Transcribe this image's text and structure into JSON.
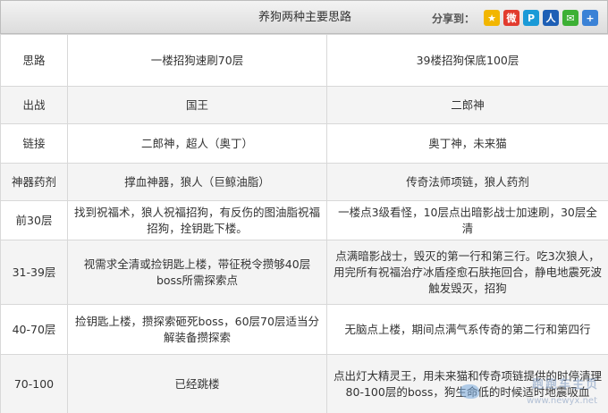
{
  "header": {
    "title": "养狗两种主要思路",
    "share_label": "分享到：",
    "share_icons": [
      {
        "name": "qzone-icon",
        "color": "#f2b600",
        "glyph": "★"
      },
      {
        "name": "weibo-icon",
        "color": "#e23b2e",
        "glyph": "微"
      },
      {
        "name": "pengyou-icon",
        "color": "#1a9ad7",
        "glyph": "P"
      },
      {
        "name": "renren-icon",
        "color": "#1e5fb5",
        "glyph": "人"
      },
      {
        "name": "wechat-icon",
        "color": "#3db035",
        "glyph": "✉"
      },
      {
        "name": "more-icon",
        "color": "#3b82d6",
        "glyph": "+"
      }
    ]
  },
  "table": {
    "rows": [
      [
        "思路",
        "一楼招狗速刷70层",
        "39楼招狗保底100层"
      ],
      [
        "出战",
        "国王",
        "二郎神"
      ],
      [
        "链接",
        "二郎神，超人（奥丁）",
        "奥丁神，未来猫"
      ],
      [
        "神器药剂",
        "撑血神器，狼人（巨鲸油脂）",
        "传奇法师项链，狼人药剂"
      ],
      [
        "前30层",
        "找到祝福术，狼人祝福招狗，有反伤的图油脂祝福招狗，拴钥匙下楼。",
        "一楼点3级看怪，10层点出暗影战士加速刷，30层全清"
      ],
      [
        "31-39层",
        "视需求全清或捡钥匙上楼，带征税令攒够40层boss所需探索点",
        "点满暗影战士，毁灭的第一行和第三行。吃3次狼人，用完所有祝福治疗冰盾痊愈石肤拖回合，静电地震死波触发毁灭，招狗"
      ],
      [
        "40-70层",
        "捡钥匙上楼，攒探索砸死boss，60层70层适当分解装备攒探索",
        "无脑点上楼，期间点满气系传奇的第二行和第四行"
      ],
      [
        "70-100",
        "已经跳楼",
        "点出灯大精灵王，用未来猫和传奇项链提供的时停清理80-100层的boss，狗生命低的时候适时地震吸血"
      ]
    ]
  },
  "watermark": {
    "text": "跑跑车主页",
    "url": "www.newyx.net"
  }
}
